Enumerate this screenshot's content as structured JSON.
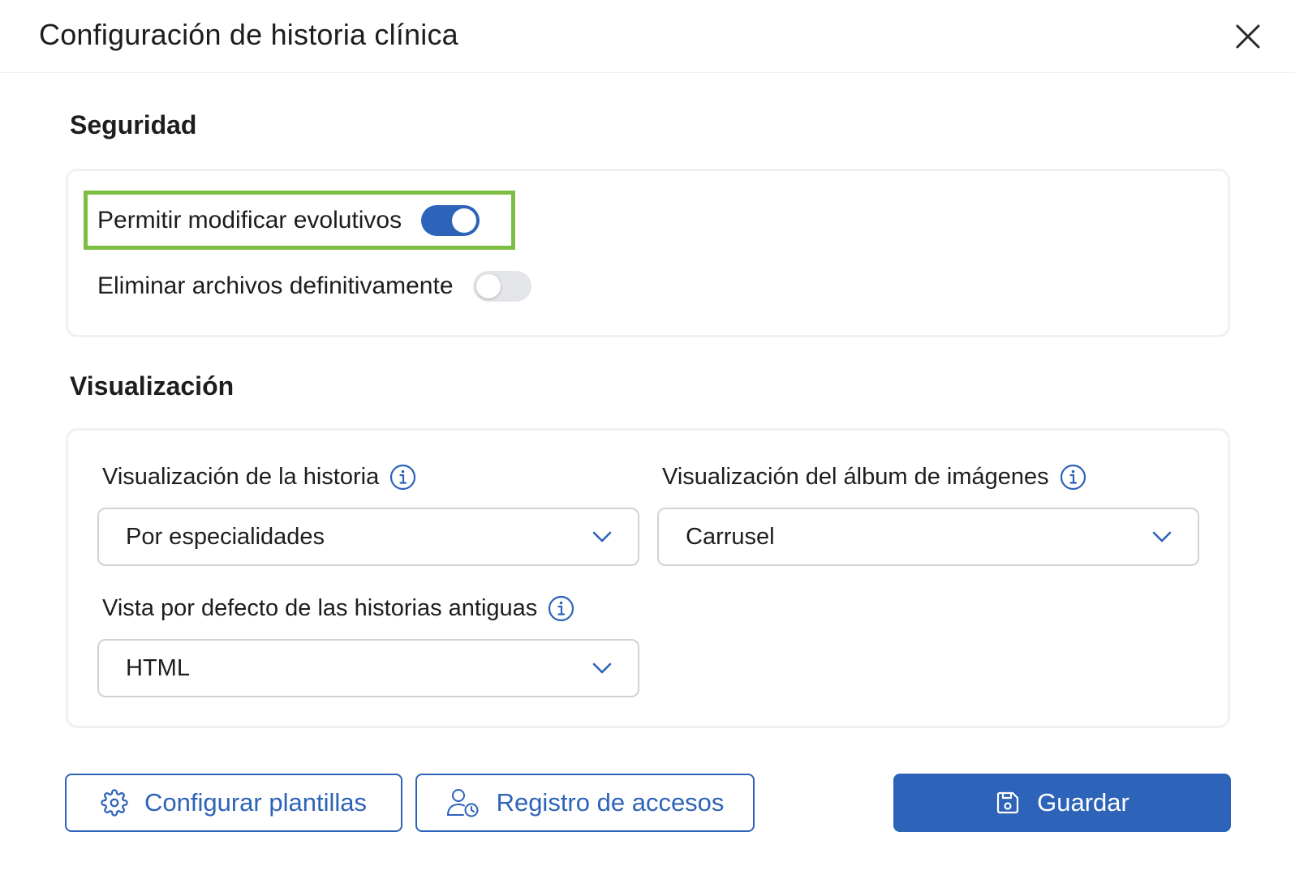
{
  "dialog": {
    "title": "Configuración de historia clínica"
  },
  "seguridad": {
    "title": "Seguridad",
    "toggles": [
      {
        "label": "Permitir modificar evolutivos",
        "state": "on"
      },
      {
        "label": "Eliminar archivos definitivamente",
        "state": "off"
      }
    ]
  },
  "visualizacion": {
    "title": "Visualización",
    "fields": [
      {
        "label": "Visualización de la historia",
        "value": "Por especialidades"
      },
      {
        "label": "Visualización del álbum de imágenes",
        "value": "Carrusel"
      },
      {
        "label": "Vista por defecto de las historias antiguas",
        "value": "HTML"
      }
    ]
  },
  "actions": {
    "config_templates": "Configurar plantillas",
    "access_log": "Registro de accesos",
    "save": "Guardar"
  },
  "colors": {
    "accent": "#2d63b8",
    "highlight": "#7cbd42"
  },
  "icons": {
    "close": "close-icon",
    "info": "info-icon",
    "chevron": "chevron-down-icon",
    "gear": "gear-icon",
    "user_clock": "user-clock-icon",
    "save": "floppy-disk-icon"
  }
}
